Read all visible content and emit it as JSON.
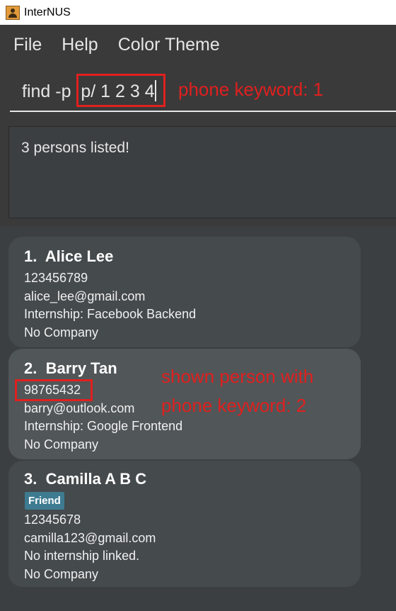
{
  "window": {
    "title": "InterNUS"
  },
  "menu": {
    "items": [
      "File",
      "Help",
      "Color Theme"
    ]
  },
  "command": {
    "text": "find -p  p/ 1 2 3 4"
  },
  "annotations": {
    "command_note": "phone keyword: 1",
    "card_note_line1": "shown person with",
    "card_note_line2": "phone keyword: 2"
  },
  "result": {
    "text": "3 persons listed!"
  },
  "persons": [
    {
      "name": "1.  Alice Lee",
      "phone": "123456789",
      "email": "alice_lee@gmail.com",
      "internship": "Internship: Facebook Backend",
      "company": "No Company"
    },
    {
      "name": "2.  Barry Tan",
      "phone": "98765432",
      "email": "barry@outlook.com",
      "internship": "Internship: Google Frontend",
      "company": "No Company"
    },
    {
      "name": "3.  Camilla A B C",
      "tag": "Friend",
      "phone": "12345678",
      "email": "camilla123@gmail.com",
      "internship": "No internship linked.",
      "company": "No Company"
    }
  ],
  "colors": {
    "background": "#3c3f41",
    "card": "#515658",
    "annotation": "#e0201f",
    "tag": "#3e7b91"
  }
}
